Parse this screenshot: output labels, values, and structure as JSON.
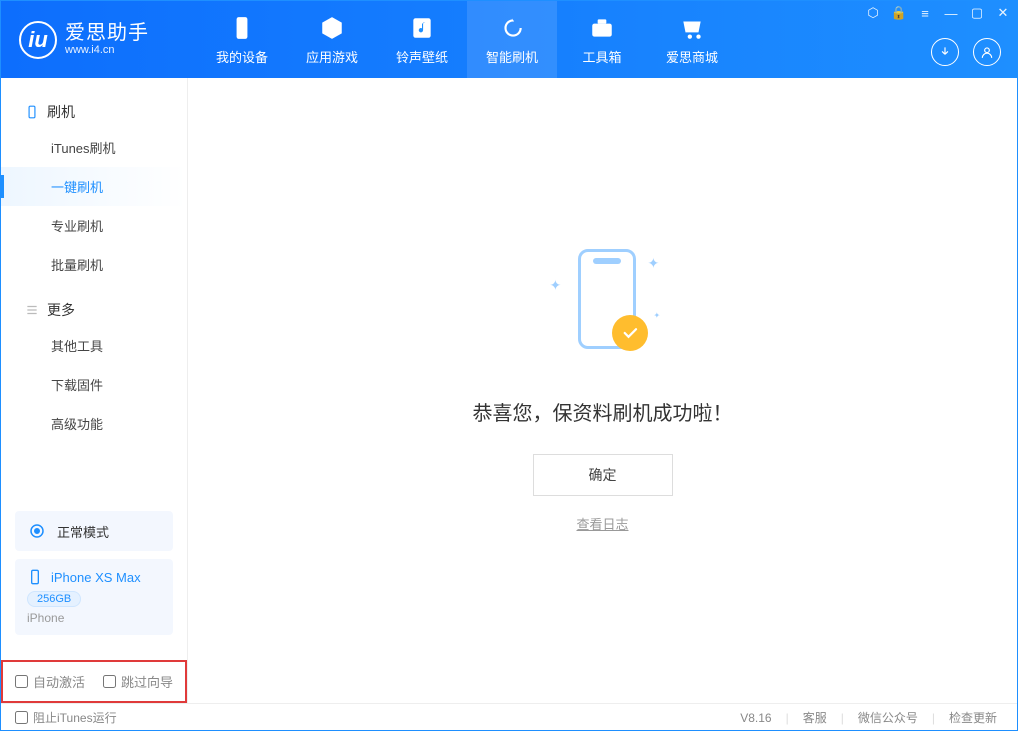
{
  "logo": {
    "mark": "iu",
    "title": "爱思助手",
    "subtitle": "www.i4.cn"
  },
  "nav": {
    "items": [
      {
        "label": "我的设备"
      },
      {
        "label": "应用游戏"
      },
      {
        "label": "铃声壁纸"
      },
      {
        "label": "智能刷机"
      },
      {
        "label": "工具箱"
      },
      {
        "label": "爱思商城"
      }
    ]
  },
  "sidebar": {
    "group1": {
      "title": "刷机",
      "items": [
        "iTunes刷机",
        "一键刷机",
        "专业刷机",
        "批量刷机"
      ]
    },
    "group2": {
      "title": "更多",
      "items": [
        "其他工具",
        "下载固件",
        "高级功能"
      ]
    },
    "mode": "正常模式",
    "device": {
      "name": "iPhone XS Max",
      "storage": "256GB",
      "type": "iPhone"
    },
    "check1": "自动激活",
    "check2": "跳过向导"
  },
  "main": {
    "success": "恭喜您，保资料刷机成功啦！",
    "ok": "确定",
    "log": "查看日志"
  },
  "footer": {
    "block_itunes": "阻止iTunes运行",
    "version": "V8.16",
    "links": [
      "客服",
      "微信公众号",
      "检查更新"
    ]
  },
  "colors": {
    "primary": "#1e8fff",
    "highlight_border": "#e03a3a"
  }
}
